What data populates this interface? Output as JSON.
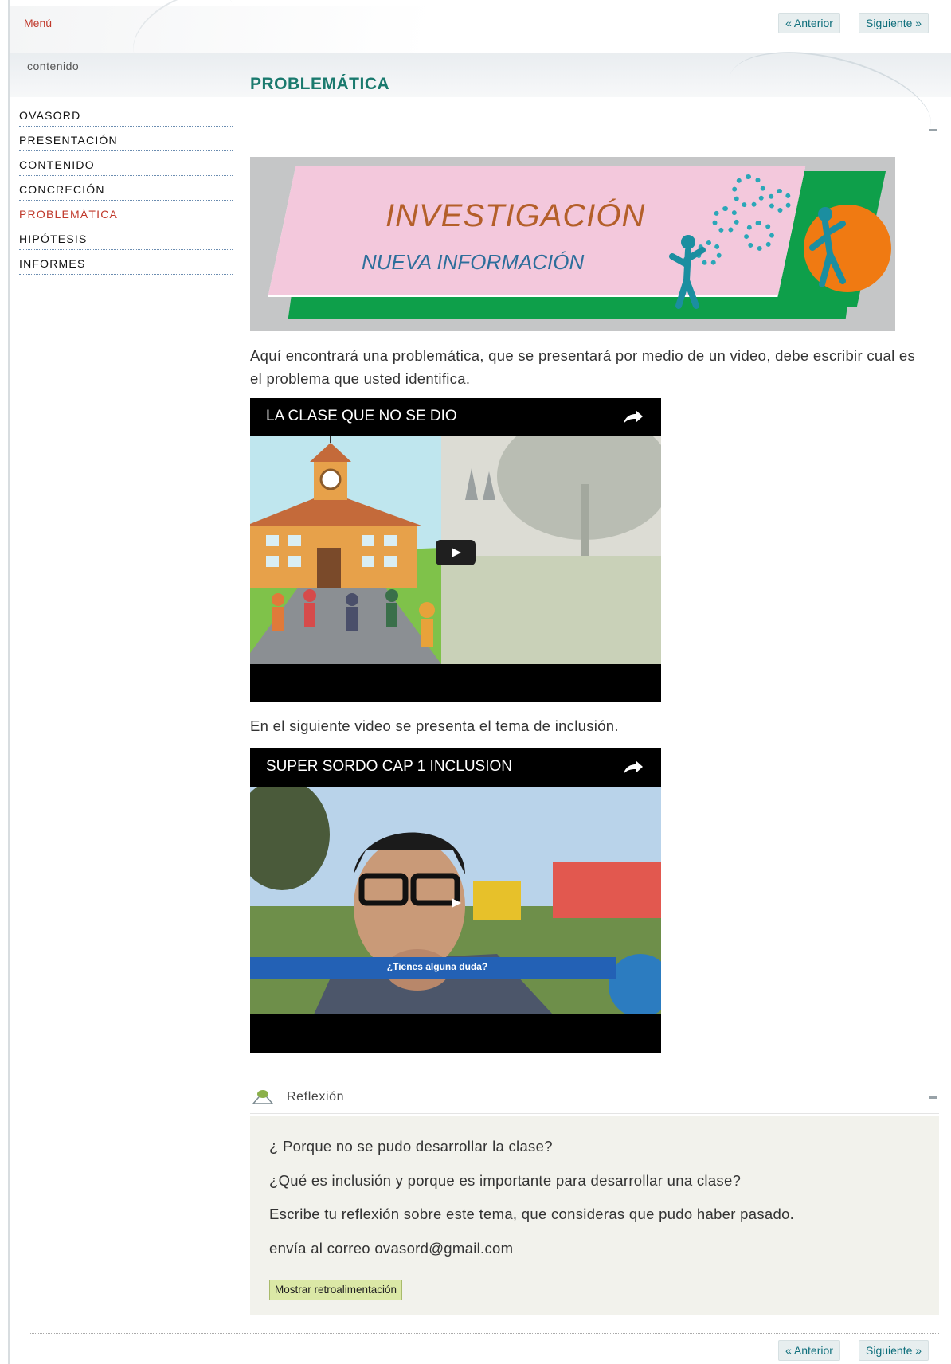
{
  "topbar": {
    "menu_label": "Menú",
    "prev_label": "« Anterior",
    "next_label": "Siguiente »"
  },
  "header": {
    "section_label": "contenido",
    "page_title": "PROBLEMÁTICA"
  },
  "sidebar": {
    "items": [
      {
        "label": "OVASORD"
      },
      {
        "label": "PRESENTACIÓN"
      },
      {
        "label": "CONTENIDO"
      },
      {
        "label": "CONCRECIÓN"
      },
      {
        "label": "PROBLEMÁTICA"
      },
      {
        "label": "HIPÓTESIS"
      },
      {
        "label": "INFORMES"
      }
    ],
    "active_color": "#c0392b"
  },
  "banner": {
    "title": "INVESTIGACIÓN",
    "subtitle": "NUEVA INFORMACIÓN"
  },
  "intro": {
    "text": "Aquí encontrará una problemática, que se presentará por medio de un video, debe escribir cual es el problema que usted identifica."
  },
  "videos": [
    {
      "title": "LA CLASE QUE NO SE DIO"
    },
    {
      "title": "SUPER SORDO CAP 1 INCLUSION",
      "caption": "¿Tienes alguna duda?"
    }
  ],
  "between_text": "En el siguiente video se presenta el tema de inclusión.",
  "reflexion": {
    "title": "Reflexión",
    "questions": [
      "¿ Porque no se pudo desarrollar la clase?",
      "¿Qué es inclusión y porque es importante para desarrollar una clase?",
      "Escribe tu reflexión sobre este tema, que consideras que pudo haber pasado.",
      "envía al correo ovasord@gmail.com"
    ],
    "feedback_button": "Mostrar retroalimentación"
  },
  "footer": {
    "prev_label": "« Anterior",
    "next_label": "Siguiente »"
  },
  "colors": {
    "title": "#1a7a6e",
    "link": "#0f6f7c",
    "accent_red": "#c0392b",
    "feedback_button": "#dbe8a6"
  }
}
